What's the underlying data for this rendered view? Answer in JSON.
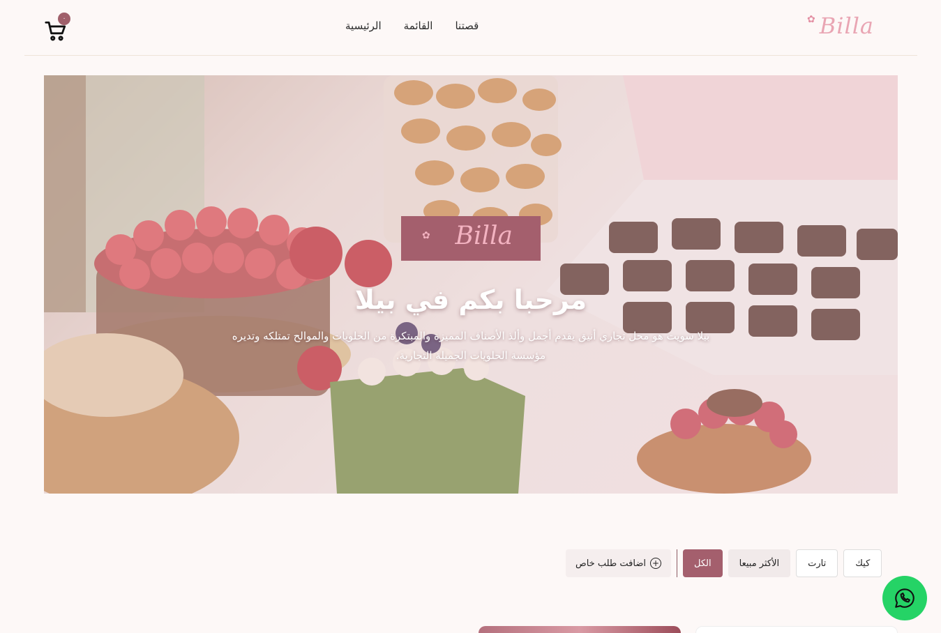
{
  "header": {
    "logo_text": "Billa",
    "nav": [
      {
        "label": "الرئيسية"
      },
      {
        "label": "القائمة"
      },
      {
        "label": "قصتنا"
      }
    ],
    "cart_count": "٠"
  },
  "hero": {
    "logo_text": "Billa",
    "title": "مرحبا بكم في بيلا",
    "subtitle": "بيلا سويت هو محل تجاري أنيق يقدم أجمل وألذ الأصناف المميزة والمبتكرة من الحلويات والموالح تمتلكه وتديره مؤسسة الحلويات الجميلة التجارية."
  },
  "filters": {
    "special_order": "اضافت طلب خاص",
    "chips": [
      {
        "label": "الكل",
        "active": true
      },
      {
        "label": "الأكثر مبيعا",
        "active": false
      },
      {
        "label": "تارت",
        "active": false
      },
      {
        "label": "كيك",
        "active": false
      }
    ]
  },
  "colors": {
    "brand": "#a45f6d",
    "logo_pink": "#e9a5b3",
    "whatsapp": "#25d366"
  }
}
